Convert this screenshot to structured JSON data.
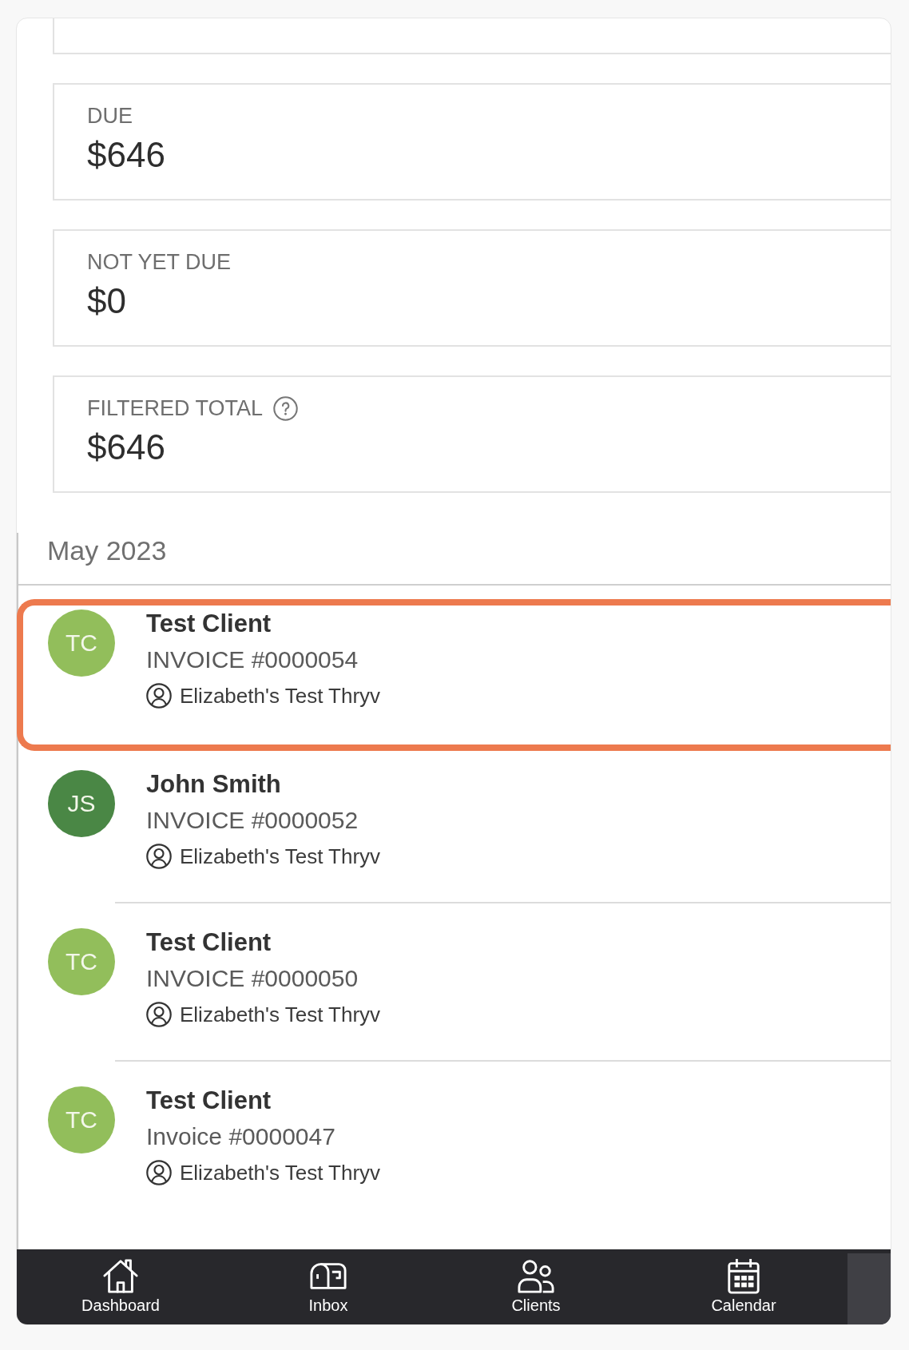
{
  "summary_cards": [
    {
      "kind": "clipped"
    },
    {
      "kind": "amount",
      "label": "DUE",
      "amount": "$646",
      "help_icon": false
    },
    {
      "kind": "amount",
      "label": "NOT YET DUE",
      "amount": "$0",
      "help_icon": false
    },
    {
      "kind": "amount",
      "label": "FILTERED TOTAL",
      "amount": "$646",
      "help_icon": true
    }
  ],
  "invoice_list": {
    "month": "May 2023",
    "items": [
      {
        "initials": "TC",
        "color": "#92be5b",
        "client": "Test Client",
        "invoice": "INVOICE #0000054",
        "business": "Elizabeth's Test Thryv",
        "selected": true
      },
      {
        "initials": "JS",
        "color": "#4a8745",
        "client": "John Smith",
        "invoice": "INVOICE #0000052",
        "business": "Elizabeth's Test Thryv",
        "selected": false
      },
      {
        "initials": "TC",
        "color": "#92be5b",
        "client": "Test Client",
        "invoice": "INVOICE #0000050",
        "business": "Elizabeth's Test Thryv",
        "selected": false
      },
      {
        "initials": "TC",
        "color": "#92be5b",
        "client": "Test Client",
        "invoice": "Invoice #0000047",
        "business": "Elizabeth's Test Thryv",
        "selected": false
      }
    ]
  },
  "bottom_nav": [
    {
      "kind": "home",
      "label": "Dashboard"
    },
    {
      "kind": "inbox",
      "label": "Inbox"
    },
    {
      "kind": "clients",
      "label": "Clients"
    },
    {
      "kind": "calendar",
      "label": "Calendar"
    }
  ]
}
